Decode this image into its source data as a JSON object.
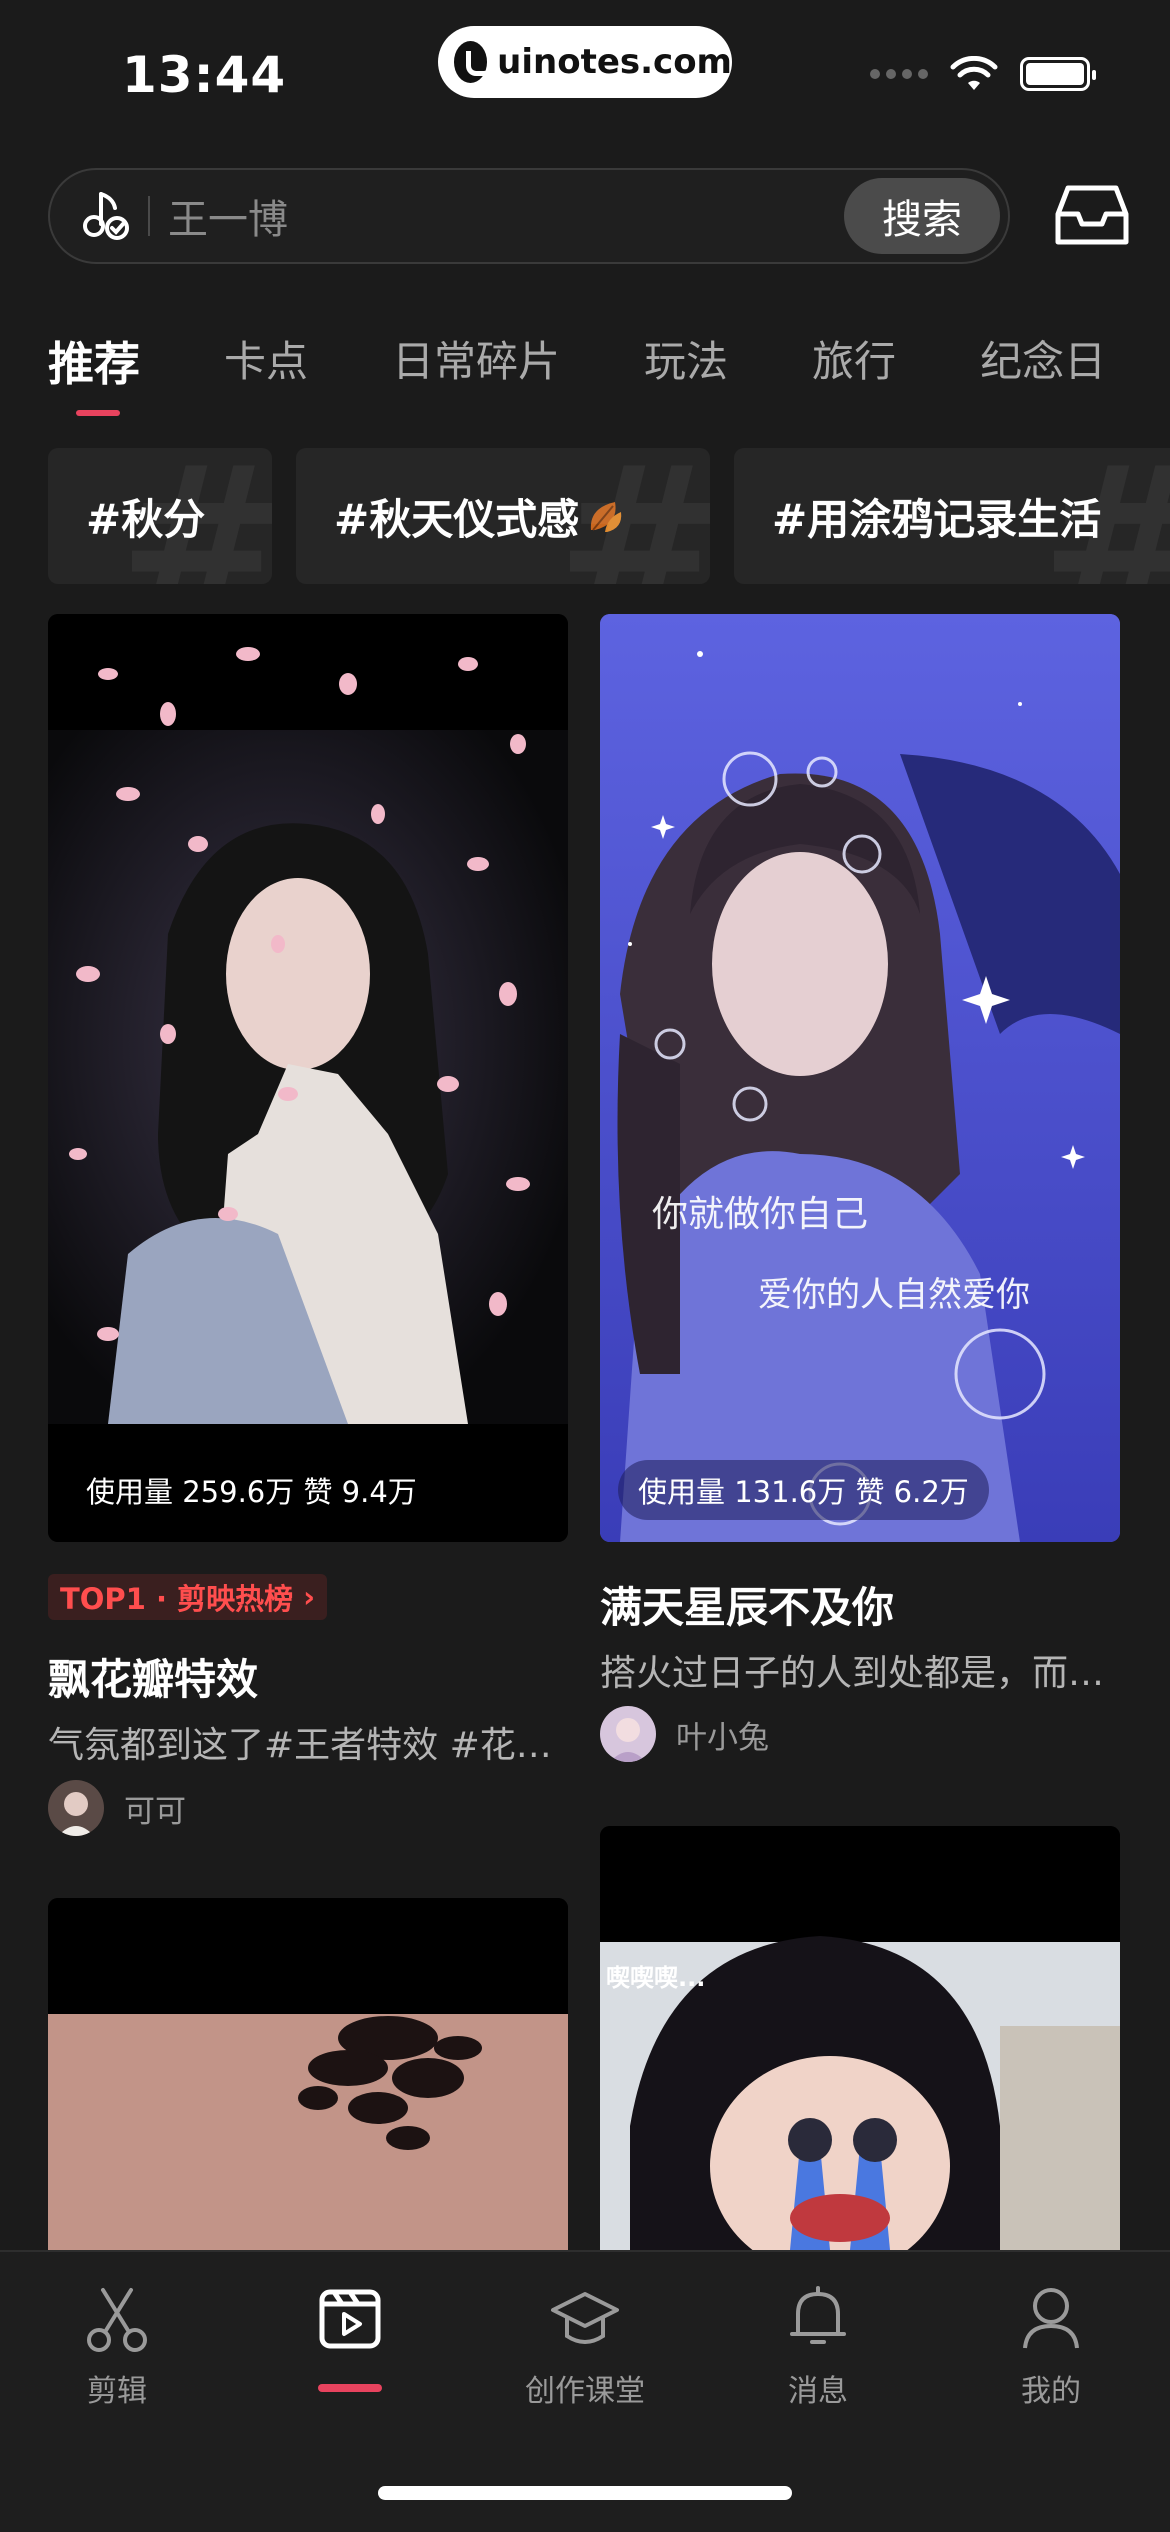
{
  "status_bar": {
    "time": "13:44",
    "site": "uinotes.com"
  },
  "search": {
    "placeholder": "王一博",
    "button": "搜索"
  },
  "tabs": [
    {
      "label": "推荐",
      "active": true
    },
    {
      "label": "卡点"
    },
    {
      "label": "日常碎片"
    },
    {
      "label": "玩法"
    },
    {
      "label": "旅行"
    },
    {
      "label": "纪念日"
    }
  ],
  "hashtags": [
    "#秋分",
    "#秋天仪式感",
    "#用涂鸦记录生活"
  ],
  "feed": [
    {
      "stats": "使用量 259.6万 赞 9.4万",
      "badge": "TOP1 · 剪映热榜",
      "title": "飘花瓣特效",
      "desc": "气氛都到这了#王者特效 #花…",
      "author": "可可"
    },
    {
      "stats": "使用量 131.6万 赞 6.2万",
      "overlay_line1": "你就做你自己",
      "overlay_line2": "爱你的人自然爱你",
      "title": "满天星辰不及你",
      "desc": "搭火过日子的人到处都是，而…",
      "author": "叶小兔"
    },
    {
      "overlay_text": "喫喫喫..."
    }
  ],
  "bottom_nav": [
    {
      "label": "剪辑",
      "icon": "scissors-icon"
    },
    {
      "label": "",
      "icon": "template-play-icon",
      "active": true
    },
    {
      "label": "创作课堂",
      "icon": "graduation-cap-icon"
    },
    {
      "label": "消息",
      "icon": "bell-icon"
    },
    {
      "label": "我的",
      "icon": "person-icon"
    }
  ],
  "colors": {
    "accent": "#e8435e",
    "background": "#1b1b1b",
    "badge_text": "#ff4e4e"
  }
}
